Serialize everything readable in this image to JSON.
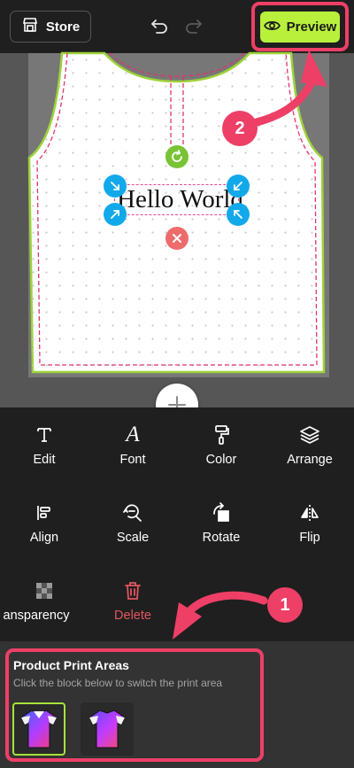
{
  "header": {
    "store_label": "Store",
    "preview_label": "Preview"
  },
  "canvas": {
    "text": "Hello World"
  },
  "badges": {
    "one": "1",
    "two": "2"
  },
  "tools": [
    {
      "label": "Edit",
      "icon": "text-t-icon"
    },
    {
      "label": "Font",
      "icon": "font-a-icon"
    },
    {
      "label": "Color",
      "icon": "paint-roller-icon"
    },
    {
      "label": "Arrange",
      "icon": "layers-icon"
    },
    {
      "label": "Align",
      "icon": "align-left-icon"
    },
    {
      "label": "Scale",
      "icon": "zoom-out-icon"
    },
    {
      "label": "Rotate",
      "icon": "rotate-icon"
    },
    {
      "label": "Flip",
      "icon": "flip-icon"
    },
    {
      "label": "ansparency",
      "icon": "checker-icon"
    },
    {
      "label": "Delete",
      "icon": "trash-icon"
    }
  ],
  "print_areas": {
    "title": "Product Print Areas",
    "subtitle": "Click the block below to switch the print area"
  },
  "colors": {
    "accent_green": "#b8f03c",
    "highlight_pink": "#ee3f66",
    "handle_blue": "#12a9ea",
    "delete_red": "#e2565f"
  }
}
